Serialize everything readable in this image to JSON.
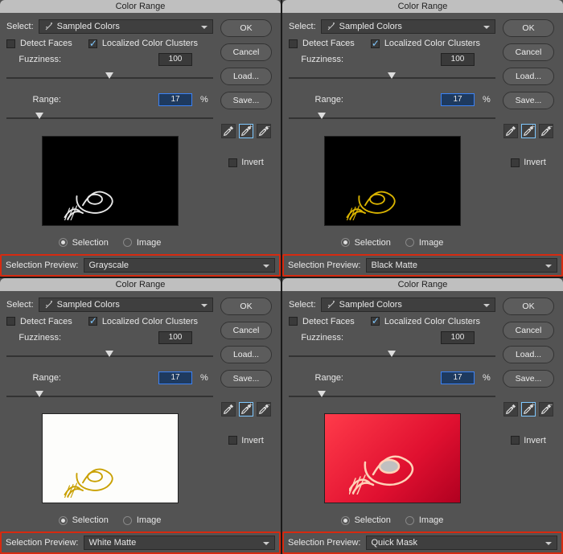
{
  "panels": [
    {
      "title": "Color Range",
      "select_label": "Select:",
      "select_value": "Sampled Colors",
      "detect_faces_label": "Detect Faces",
      "detect_faces_checked": false,
      "localized_label": "Localized Color Clusters",
      "localized_checked": true,
      "fuzziness_label": "Fuzziness:",
      "fuzziness_value": "100",
      "range_label": "Range:",
      "range_value": "17",
      "percent": "%",
      "selection_label": "Selection",
      "image_label": "Image",
      "sel_preview_label": "Selection Preview:",
      "sel_preview_value": "Grayscale",
      "buttons": {
        "ok": "OK",
        "cancel": "Cancel",
        "load": "Load...",
        "save": "Save..."
      },
      "invert_label": "Invert",
      "preview_mode": "grayscale"
    },
    {
      "title": "Color Range",
      "select_label": "Select:",
      "select_value": "Sampled Colors",
      "detect_faces_label": "Detect Faces",
      "detect_faces_checked": false,
      "localized_label": "Localized Color Clusters",
      "localized_checked": true,
      "fuzziness_label": "Fuzziness:",
      "fuzziness_value": "100",
      "range_label": "Range:",
      "range_value": "17",
      "percent": "%",
      "selection_label": "Selection",
      "image_label": "Image",
      "sel_preview_label": "Selection Preview:",
      "sel_preview_value": "Black Matte",
      "buttons": {
        "ok": "OK",
        "cancel": "Cancel",
        "load": "Load...",
        "save": "Save..."
      },
      "invert_label": "Invert",
      "preview_mode": "black"
    },
    {
      "title": "Color Range",
      "select_label": "Select:",
      "select_value": "Sampled Colors",
      "detect_faces_label": "Detect Faces",
      "detect_faces_checked": false,
      "localized_label": "Localized Color Clusters",
      "localized_checked": true,
      "fuzziness_label": "Fuzziness:",
      "fuzziness_value": "100",
      "range_label": "Range:",
      "range_value": "17",
      "percent": "%",
      "selection_label": "Selection",
      "image_label": "Image",
      "sel_preview_label": "Selection Preview:",
      "sel_preview_value": "White Matte",
      "buttons": {
        "ok": "OK",
        "cancel": "Cancel",
        "load": "Load...",
        "save": "Save..."
      },
      "invert_label": "Invert",
      "preview_mode": "white"
    },
    {
      "title": "Color Range",
      "select_label": "Select:",
      "select_value": "Sampled Colors",
      "detect_faces_label": "Detect Faces",
      "detect_faces_checked": false,
      "localized_label": "Localized Color Clusters",
      "localized_checked": true,
      "fuzziness_label": "Fuzziness:",
      "fuzziness_value": "100",
      "range_label": "Range:",
      "range_value": "17",
      "percent": "%",
      "selection_label": "Selection",
      "image_label": "Image",
      "sel_preview_label": "Selection Preview:",
      "sel_preview_value": "Quick Mask",
      "buttons": {
        "ok": "OK",
        "cancel": "Cancel",
        "load": "Load...",
        "save": "Save..."
      },
      "invert_label": "Invert",
      "preview_mode": "qmask"
    }
  ]
}
